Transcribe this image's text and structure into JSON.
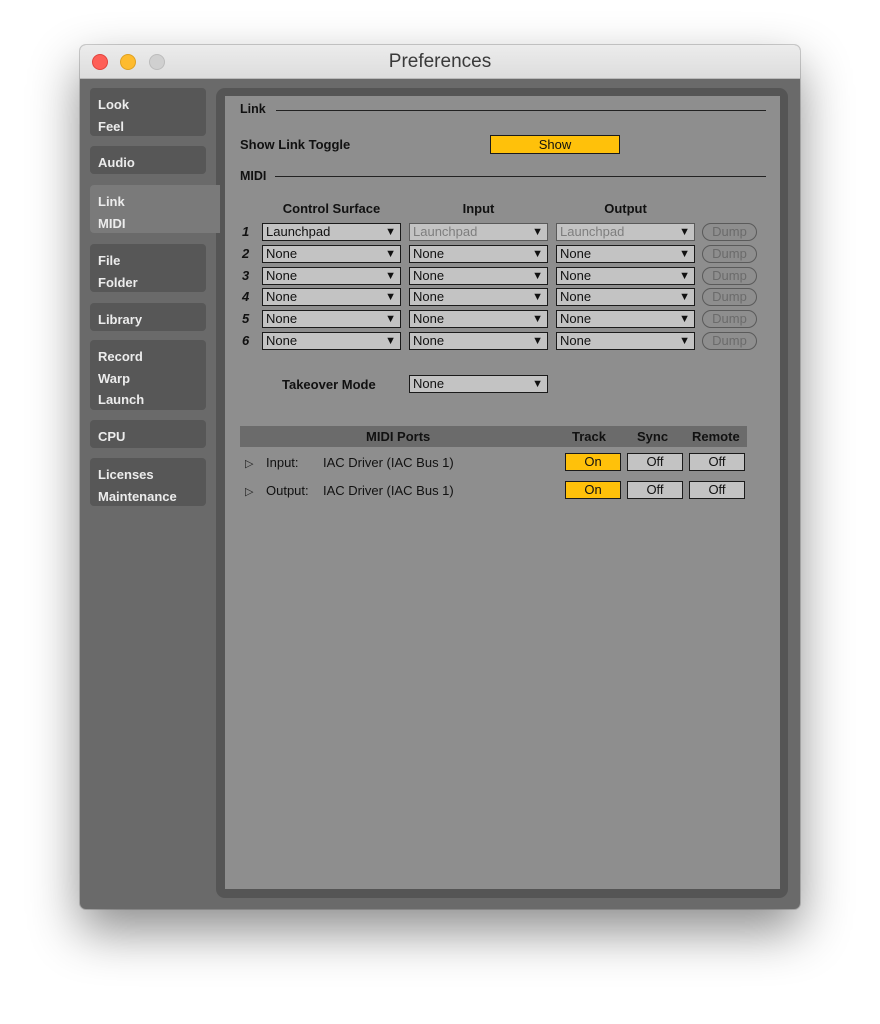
{
  "window": {
    "title": "Preferences"
  },
  "sidebar": {
    "items": [
      {
        "lines": [
          "Look",
          "Feel"
        ]
      },
      {
        "lines": [
          "Audio"
        ]
      },
      {
        "lines": [
          "Link",
          "MIDI"
        ],
        "active": true
      },
      {
        "lines": [
          "File",
          "Folder"
        ]
      },
      {
        "lines": [
          "Library"
        ]
      },
      {
        "lines": [
          "Record",
          "Warp",
          "Launch"
        ]
      },
      {
        "lines": [
          "CPU"
        ]
      },
      {
        "lines": [
          "Licenses",
          "Maintenance"
        ]
      }
    ]
  },
  "link": {
    "section_title": "Link",
    "show_toggle_label": "Show Link Toggle",
    "show_toggle_value": "Show"
  },
  "midi": {
    "section_title": "MIDI",
    "columns": {
      "control_surface": "Control Surface",
      "input": "Input",
      "output": "Output"
    },
    "rows": [
      {
        "num": "1",
        "surface": "Launchpad",
        "input": "Launchpad",
        "output": "Launchpad",
        "dump": "Dump"
      },
      {
        "num": "2",
        "surface": "None",
        "input": "None",
        "output": "None",
        "dump": "Dump"
      },
      {
        "num": "3",
        "surface": "None",
        "input": "None",
        "output": "None",
        "dump": "Dump"
      },
      {
        "num": "4",
        "surface": "None",
        "input": "None",
        "output": "None",
        "dump": "Dump"
      },
      {
        "num": "5",
        "surface": "None",
        "input": "None",
        "output": "None",
        "dump": "Dump"
      },
      {
        "num": "6",
        "surface": "None",
        "input": "None",
        "output": "None",
        "dump": "Dump"
      }
    ],
    "takeover_label": "Takeover Mode",
    "takeover_value": "None"
  },
  "ports": {
    "headers": {
      "ports": "MIDI Ports",
      "track": "Track",
      "sync": "Sync",
      "remote": "Remote"
    },
    "rows": [
      {
        "kind": "Input:",
        "name": "IAC Driver (IAC Bus 1)",
        "track": "On",
        "sync": "Off",
        "remote": "Off"
      },
      {
        "kind": "Output:",
        "name": "IAC Driver (IAC Bus 1)",
        "track": "On",
        "sync": "Off",
        "remote": "Off"
      }
    ]
  },
  "colors": {
    "accent": "#ffc10a",
    "panel": "#8e8e8e",
    "sidebar": "#575757"
  }
}
